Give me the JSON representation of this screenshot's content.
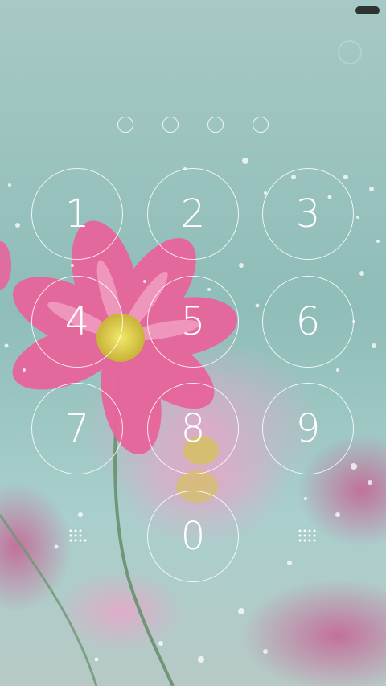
{
  "lockscreen": {
    "keys": [
      {
        "digit": "1"
      },
      {
        "digit": "2"
      },
      {
        "digit": "3"
      },
      {
        "digit": "4"
      },
      {
        "digit": "5"
      },
      {
        "digit": "6"
      },
      {
        "digit": "7"
      },
      {
        "digit": "8"
      },
      {
        "digit": "9"
      },
      {
        "digit": "0"
      }
    ],
    "passcode_dots": 4,
    "left_grip_icon": "dots-grid-icon",
    "right_grip_icon": "dots-grid-icon",
    "status_icon": "battery-icon"
  },
  "colors": {
    "background": "#9cc4bf",
    "flower_pink": "#e8649b",
    "flower_center": "#e9dc5a"
  }
}
